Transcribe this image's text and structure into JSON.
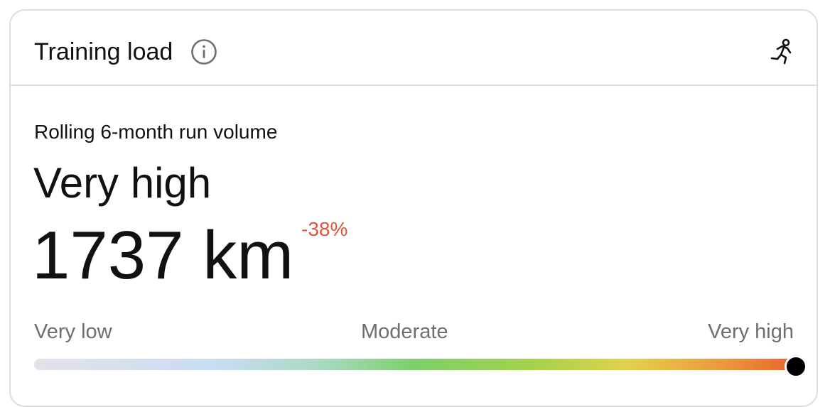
{
  "card": {
    "title": "Training load",
    "info_icon": "info-circle-icon",
    "activity_icon": "running-person-icon"
  },
  "metric": {
    "subtitle": "Rolling 6-month run volume",
    "level": "Very high",
    "value": "1737 km",
    "change": "-38%"
  },
  "scale": {
    "low_label": "Very low",
    "mid_label": "Moderate",
    "high_label": "Very high",
    "position": 1.0
  },
  "colors": {
    "change": "#e0553a",
    "secondary_text": "#6e6e73",
    "border": "#dddddd"
  }
}
